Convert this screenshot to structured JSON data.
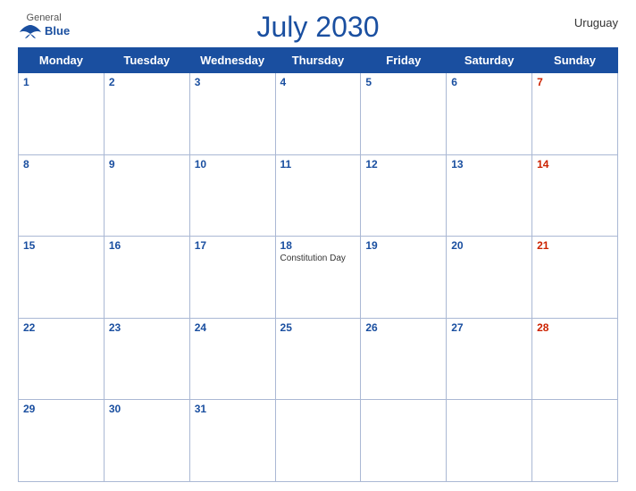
{
  "title": "July 2030",
  "country": "Uruguay",
  "logo": {
    "general": "General",
    "blue": "Blue"
  },
  "days_of_week": [
    "Monday",
    "Tuesday",
    "Wednesday",
    "Thursday",
    "Friday",
    "Saturday",
    "Sunday"
  ],
  "weeks": [
    [
      {
        "day": 1,
        "holiday": ""
      },
      {
        "day": 2,
        "holiday": ""
      },
      {
        "day": 3,
        "holiday": ""
      },
      {
        "day": 4,
        "holiday": ""
      },
      {
        "day": 5,
        "holiday": ""
      },
      {
        "day": 6,
        "holiday": ""
      },
      {
        "day": 7,
        "holiday": "",
        "sunday": true
      }
    ],
    [
      {
        "day": 8,
        "holiday": ""
      },
      {
        "day": 9,
        "holiday": ""
      },
      {
        "day": 10,
        "holiday": ""
      },
      {
        "day": 11,
        "holiday": ""
      },
      {
        "day": 12,
        "holiday": ""
      },
      {
        "day": 13,
        "holiday": ""
      },
      {
        "day": 14,
        "holiday": "",
        "sunday": true
      }
    ],
    [
      {
        "day": 15,
        "holiday": ""
      },
      {
        "day": 16,
        "holiday": ""
      },
      {
        "day": 17,
        "holiday": ""
      },
      {
        "day": 18,
        "holiday": "Constitution Day"
      },
      {
        "day": 19,
        "holiday": ""
      },
      {
        "day": 20,
        "holiday": ""
      },
      {
        "day": 21,
        "holiday": "",
        "sunday": true
      }
    ],
    [
      {
        "day": 22,
        "holiday": ""
      },
      {
        "day": 23,
        "holiday": ""
      },
      {
        "day": 24,
        "holiday": ""
      },
      {
        "day": 25,
        "holiday": ""
      },
      {
        "day": 26,
        "holiday": ""
      },
      {
        "day": 27,
        "holiday": ""
      },
      {
        "day": 28,
        "holiday": "",
        "sunday": true
      }
    ],
    [
      {
        "day": 29,
        "holiday": ""
      },
      {
        "day": 30,
        "holiday": ""
      },
      {
        "day": 31,
        "holiday": ""
      },
      {
        "day": null,
        "holiday": ""
      },
      {
        "day": null,
        "holiday": ""
      },
      {
        "day": null,
        "holiday": ""
      },
      {
        "day": null,
        "holiday": ""
      }
    ]
  ]
}
